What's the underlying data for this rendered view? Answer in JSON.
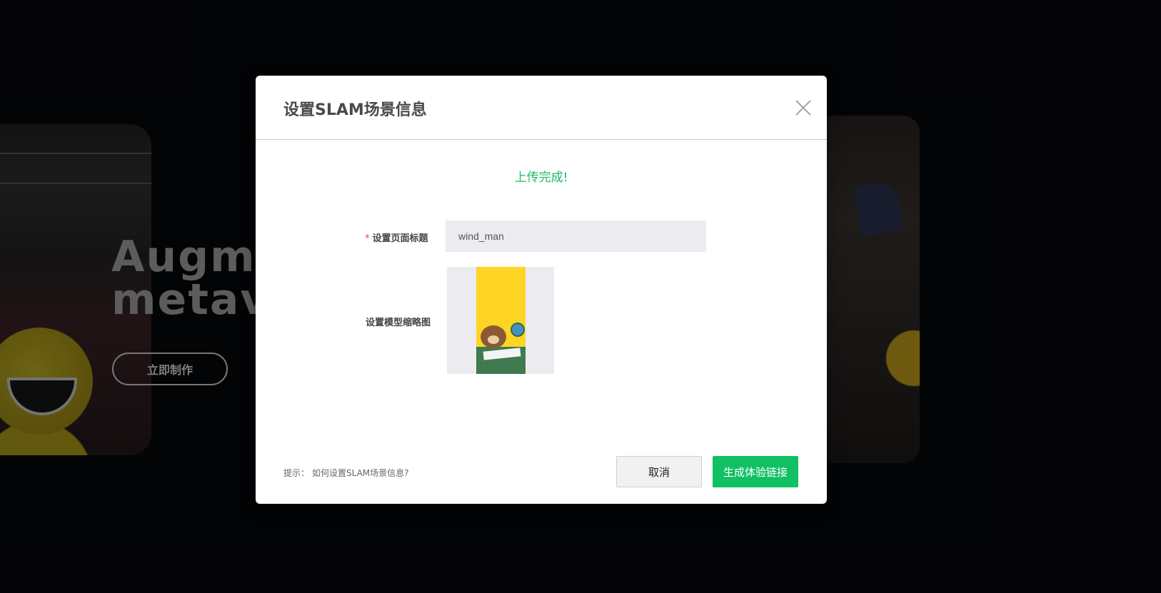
{
  "background": {
    "hero_title": "Augmented\nmetaverse",
    "hero_button": "立即制作"
  },
  "modal": {
    "title": "设置SLAM场景信息",
    "status": "上传完成!",
    "page_title_field": {
      "required_mark": "*",
      "label": "设置页面标题",
      "value": "wind_man"
    },
    "thumbnail_field": {
      "label": "设置模型缩略图"
    },
    "hint_prefix": "提示：",
    "hint_link": "如何设置SLAM场景信息?",
    "cancel_label": "取消",
    "confirm_label": "生成体验链接"
  },
  "icons": {
    "close": "close-icon"
  },
  "colors": {
    "accent": "#10c063",
    "status": "#1fbb62",
    "required": "#e64545"
  }
}
